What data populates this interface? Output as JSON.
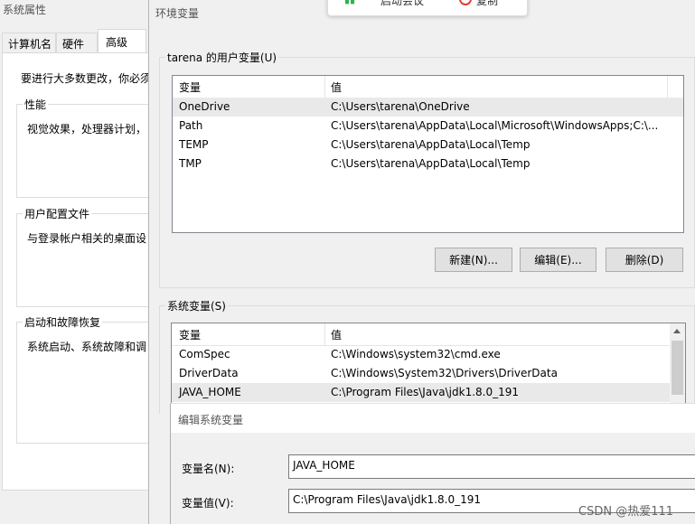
{
  "sysprops": {
    "title": "系统属性",
    "tabs": [
      "计算机名",
      "硬件",
      "高级"
    ],
    "intro": "要进行大多数更改，你必须",
    "performance": {
      "label": "性能",
      "desc": "视觉效果，处理器计划，"
    },
    "profile": {
      "label": "用户配置文件",
      "desc": "与登录帐户相关的桌面设"
    },
    "startup": {
      "label": "启动和故障恢复",
      "desc": "系统启动、系统故障和调"
    }
  },
  "toast": {
    "item1": "启动会议",
    "item2": "复制"
  },
  "env": {
    "title": "环境变量",
    "user_group_label": "tarena 的用户变量(U)",
    "col_var": "变量",
    "col_val": "值",
    "user_vars": [
      {
        "name": "OneDrive",
        "value": "C:\\Users\\tarena\\OneDrive"
      },
      {
        "name": "Path",
        "value": "C:\\Users\\tarena\\AppData\\Local\\Microsoft\\WindowsApps;C:\\..."
      },
      {
        "name": "TEMP",
        "value": "C:\\Users\\tarena\\AppData\\Local\\Temp"
      },
      {
        "name": "TMP",
        "value": "C:\\Users\\tarena\\AppData\\Local\\Temp"
      }
    ],
    "buttons": {
      "new": "新建(N)...",
      "edit": "编辑(E)...",
      "delete": "删除(D)"
    },
    "sys_group_label": "系统变量(S)",
    "sys_vars": [
      {
        "name": "ComSpec",
        "value": "C:\\Windows\\system32\\cmd.exe"
      },
      {
        "name": "DriverData",
        "value": "C:\\Windows\\System32\\Drivers\\DriverData"
      },
      {
        "name": "JAVA_HOME",
        "value": "C:\\Program Files\\Java\\jdk1.8.0_191"
      }
    ]
  },
  "edit_dialog": {
    "title": "编辑系统变量",
    "name_label": "变量名(N):",
    "name_value": "JAVA_HOME",
    "value_label": "变量值(V):",
    "value_value": "C:\\Program Files\\Java\\jdk1.8.0_191"
  },
  "watermark": "CSDN @热爱111"
}
